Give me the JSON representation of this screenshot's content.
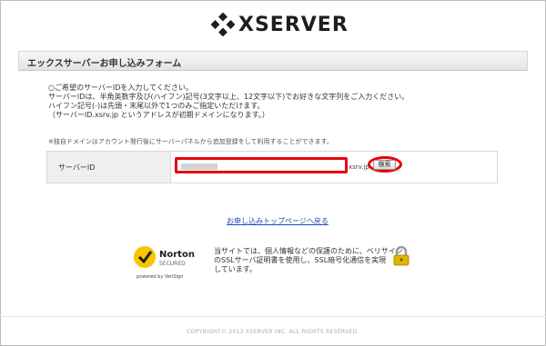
{
  "brand": {
    "name": "XSERVER"
  },
  "form_title": "エックスサーバーお申し込みフォーム",
  "instructions": [
    "○ご希望のサーバーIDを入力してください。",
    "サーバーIDは、半角英数字及び(ハイフン)記号(3文字以上、12文字以下)でお好きな文字列をご入力ください。",
    "ハイフン記号(-)は先頭・末尾以外で1つのみご指定いただけます。",
    "（サーバーID.xsrv.jp というアドレスが初期ドメインになります。）"
  ],
  "note": "※独自ドメインはアカウント発行後にサーバーパネルから追加登録をして利用することができます。",
  "server_id": {
    "label": "サーバーID",
    "value": "",
    "suffix": "xsrv.jp",
    "search_label": "検索"
  },
  "back_link": "お申し込みトップページへ戻る",
  "security": {
    "badge": {
      "brand": "Norton",
      "secured": "SECURED",
      "powered": "powered by VeriSign"
    },
    "lines": [
      "当サイトでは、個人情報などの保護のために、ベリサイン",
      "のSSLサーバ証明書を使用し、SSL暗号化通信を実現",
      "しています。"
    ]
  },
  "footer": "COPYRIGHT© 2013 XSERVER INC. ALL RIGHTS RESERVED.",
  "colors": {
    "highlight": "#e8000b",
    "link": "#1a4fb5",
    "norton_yellow": "#f7c600"
  }
}
